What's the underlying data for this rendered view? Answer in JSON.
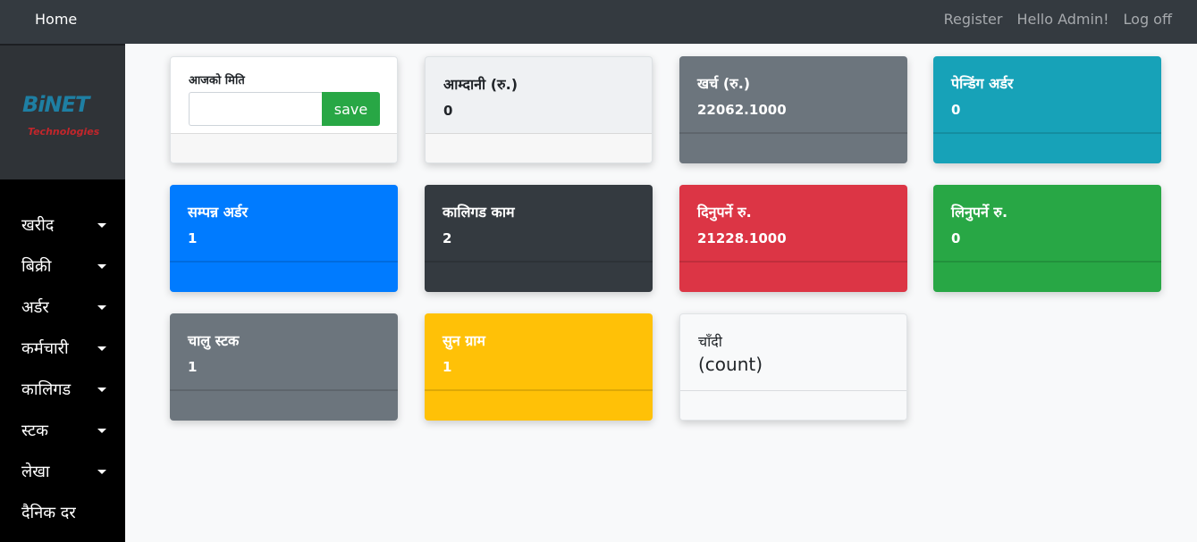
{
  "topbar": {
    "home": "Home",
    "register": "Register",
    "hello": "Hello Admin!",
    "logoff": "Log off"
  },
  "logo": {
    "word": "BiNET",
    "sub": "Technologies"
  },
  "sidebar": {
    "items": [
      {
        "label": "खरीद"
      },
      {
        "label": "बिक्री"
      },
      {
        "label": "अर्डर"
      },
      {
        "label": "कर्मचारी"
      },
      {
        "label": "कालिगड"
      },
      {
        "label": "स्टक"
      },
      {
        "label": "लेखा"
      },
      {
        "label": "दैनिक दर"
      }
    ]
  },
  "date_card": {
    "label": "आजको मिति",
    "input_value": "",
    "save_label": "save"
  },
  "cards": [
    {
      "title": "आम्दानी (रु.)",
      "value": "0"
    },
    {
      "title": "खर्च (रु.)",
      "value": "22062.1000"
    },
    {
      "title": "पेन्डिंग अर्डर",
      "value": "0"
    },
    {
      "title": "सम्पन्न अर्डर",
      "value": "1"
    },
    {
      "title": "कालिगड काम",
      "value": "2"
    },
    {
      "title": "दिनुपर्ने रु.",
      "value": "21228.1000"
    },
    {
      "title": "लिनुपर्ने रु.",
      "value": "0"
    },
    {
      "title": "चालु स्टक",
      "value": "1"
    },
    {
      "title": "सुन ग्राम",
      "value": "1"
    },
    {
      "title": "चाँदी",
      "value": "(count)"
    }
  ],
  "colors": {
    "topbar": "#343a40",
    "sidebar": "#000000",
    "grey": "#6c757d",
    "teal": "#17a2b8",
    "blue": "#007bff",
    "dark": "#343a40",
    "red": "#dc3545",
    "green": "#28a745",
    "yellow": "#ffc107"
  }
}
